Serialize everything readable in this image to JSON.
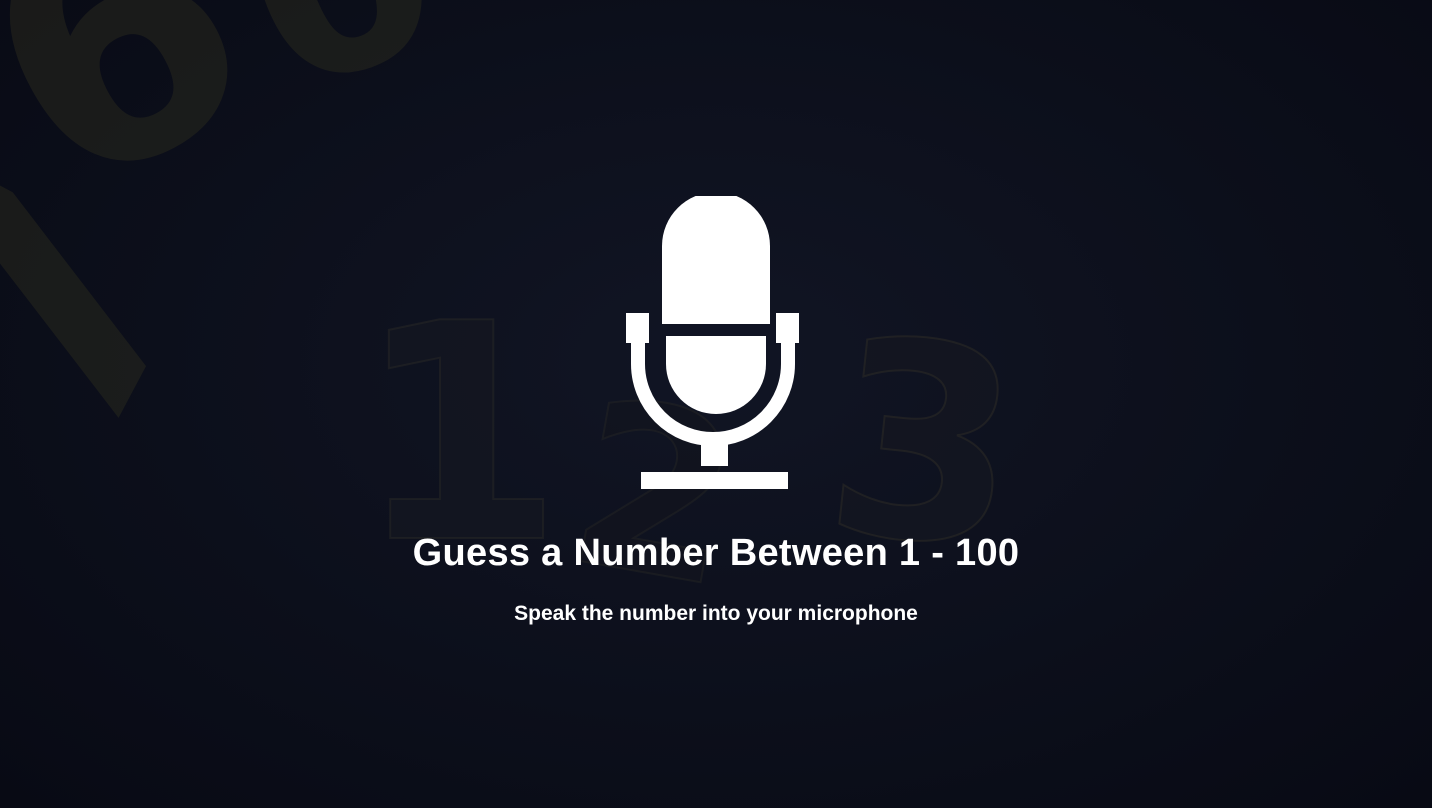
{
  "main": {
    "title": "Guess a Number Between 1 - 100",
    "subtitle": "Speak the number into your microphone",
    "icon": "microphone-icon"
  },
  "background": {
    "description_glyphs": [
      "6",
      "0",
      "7",
      "1",
      "2",
      "3"
    ],
    "colors": {
      "base": "#0c0f1b",
      "glyph_tint": "#3c3a28",
      "text": "#ffffff"
    }
  }
}
